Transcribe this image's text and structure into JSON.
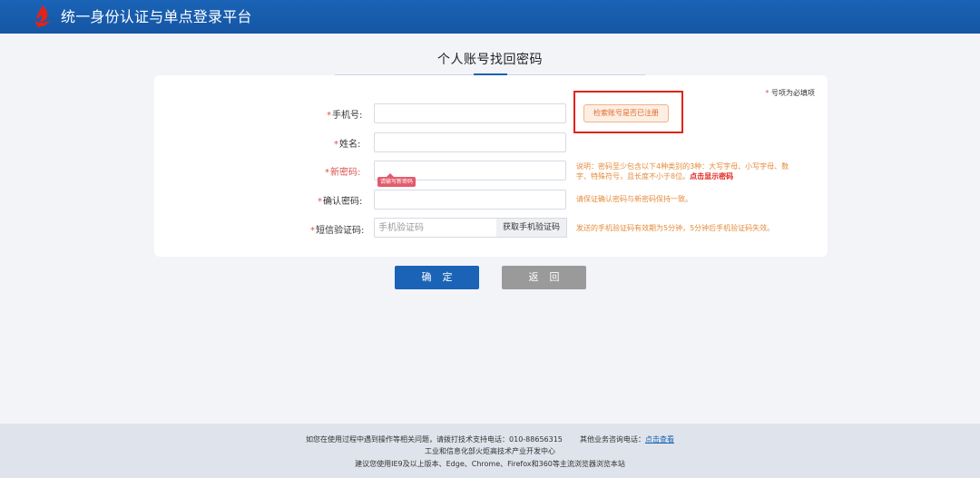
{
  "header": {
    "title": "统一身份认证与单点登录平台"
  },
  "page": {
    "title": "个人账号找回密码"
  },
  "form": {
    "required_note_star": "*",
    "required_note_text": " 号项为必填项",
    "fields": {
      "phone": {
        "label": "手机号:",
        "value": ""
      },
      "name": {
        "label": "姓名:",
        "value": ""
      },
      "new_password": {
        "label": "新密码:",
        "value": ""
      },
      "confirm_password": {
        "label": "确认密码:",
        "value": ""
      },
      "sms_code": {
        "label": "短信验证码:",
        "placeholder": "手机验证码"
      }
    },
    "required_star": "*",
    "check_account_button": "检索账号是否已注册",
    "get_sms_button": "获取手机验证码",
    "new_password_tooltip": "请输写新密码",
    "hints": {
      "password_rule": "说明：密码至少包含以下4种类别的3种：大写字母、小写字母、数字、特殊符号，且长度不小于8位。",
      "show_password": "点击显示密码",
      "confirm_rule": "请保证确认密码与新密码保持一致。",
      "sms_rule": "发送的手机验证码有效期为5分钟，5分钟后手机验证码失效。"
    }
  },
  "actions": {
    "confirm": "确定",
    "back": "返回"
  },
  "footer": {
    "line1_prefix": "如您在使用过程中遇到操作等相关问题，请拨打技术支持电话：010-88656315",
    "line1_middle": "其他业务咨询电话：",
    "line1_link": "点击查看",
    "line2": "工业和信息化部火炬高技术产业开发中心",
    "line3": "建议您使用IE9及以上版本、Edge、Chrome、Firefox和360等主流浏览器浏览本站"
  },
  "colors": {
    "brand_blue": "#1a63b6",
    "required_red": "#d9534f",
    "hint_orange": "#e58b3a",
    "highlight_red": "#e2231a"
  },
  "icons": {
    "logo": "torch-logo-icon"
  }
}
